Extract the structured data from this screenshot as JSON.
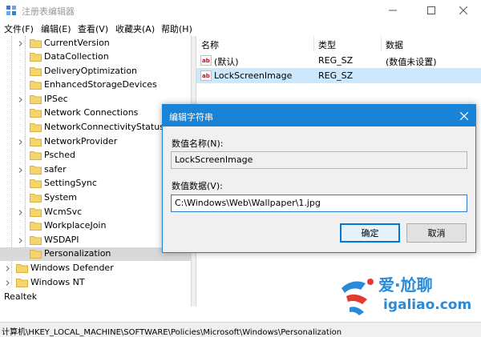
{
  "window": {
    "title": "注册表编辑器",
    "icon": "registry-editor-icon"
  },
  "menu": [
    "文件(F)",
    "编辑(E)",
    "查看(V)",
    "收藏夹(A)",
    "帮助(H)"
  ],
  "tree": {
    "items": [
      {
        "label": "CurrentVersion",
        "expandable": true
      },
      {
        "label": "DataCollection",
        "expandable": false
      },
      {
        "label": "DeliveryOptimization",
        "expandable": false
      },
      {
        "label": "EnhancedStorageDevices",
        "expandable": false
      },
      {
        "label": "IPSec",
        "expandable": true
      },
      {
        "label": "Network Connections",
        "expandable": false
      },
      {
        "label": "NetworkConnectivityStatusIndicator",
        "expandable": false
      },
      {
        "label": "NetworkProvider",
        "expandable": true
      },
      {
        "label": "Psched",
        "expandable": false
      },
      {
        "label": "safer",
        "expandable": true
      },
      {
        "label": "SettingSync",
        "expandable": false
      },
      {
        "label": "System",
        "expandable": false
      },
      {
        "label": "WcmSvc",
        "expandable": true
      },
      {
        "label": "WorkplaceJoin",
        "expandable": false
      },
      {
        "label": "WSDAPI",
        "expandable": true
      },
      {
        "label": "Personalization",
        "expandable": false,
        "selected": true
      }
    ],
    "parent_items": [
      {
        "label": "Windows Defender",
        "expandable": true
      },
      {
        "label": "Windows NT",
        "expandable": true
      }
    ],
    "root_item": {
      "label": "Realtek"
    }
  },
  "list": {
    "headers": {
      "name": "名称",
      "type": "类型",
      "data": "数据"
    },
    "rows": [
      {
        "name": "(默认)",
        "type": "REG_SZ",
        "data": "(数值未设置)",
        "selected": false
      },
      {
        "name": "LockScreenImage",
        "type": "REG_SZ",
        "data": "",
        "selected": true
      }
    ]
  },
  "dialog": {
    "title": "编辑字符串",
    "name_label": "数值名称(N):",
    "name_value": "LockScreenImage",
    "data_label": "数值数据(V):",
    "data_value": "C:\\Windows\\Web\\Wallpaper\\1.jpg",
    "ok_label": "确定",
    "cancel_label": "取消"
  },
  "status": {
    "path": "计算机\\HKEY_LOCAL_MACHINE\\SOFTWARE\\Policies\\Microsoft\\Windows\\Personalization"
  },
  "watermark": {
    "name": "爱·尬聊",
    "site": "igaliao.com"
  },
  "colors": {
    "accent": "#1883d7",
    "selection": "#cce8ff",
    "folder": "#f5d46c",
    "watermark": "#2a8ad8",
    "watermark_red": "#e23a2d"
  }
}
